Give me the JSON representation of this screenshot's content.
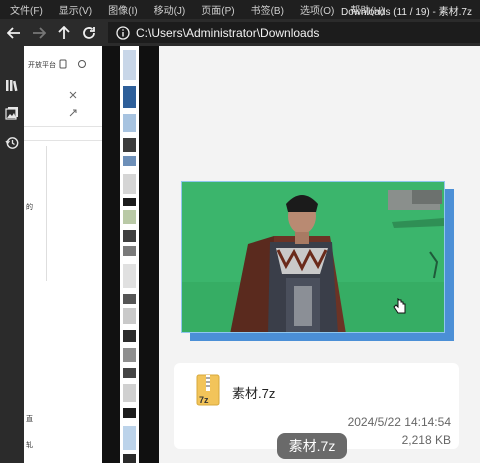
{
  "menubar": {
    "items": [
      "文件(F)",
      "显示(V)",
      "图像(I)",
      "移动(J)",
      "页面(P)",
      "书签(B)",
      "选项(O)",
      "帮助(H)"
    ],
    "window_title": "Downloads (11 / 19) - 素材.7z"
  },
  "toolbar": {
    "icons": [
      "back-arrow-icon",
      "forward-arrow-icon",
      "up-arrow-icon",
      "refresh-icon"
    ],
    "address": "C:\\Users\\Administrator\\Downloads"
  },
  "sidebar": {
    "icons": [
      "library-icon",
      "gallery-icon",
      "history-icon"
    ]
  },
  "background_window": {
    "fragment_top": "开放平台",
    "fragment_mid": "的",
    "fragment_low1": "直",
    "fragment_low2": "轧"
  },
  "file_card": {
    "icon_label": "7z",
    "name": "素材.7z",
    "date": "2024/5/22 14:14:54",
    "size": "2,218 KB"
  },
  "tooltip": {
    "text": "素材.7z"
  },
  "colors": {
    "accent_blue": "#4b8fd6",
    "green_screen": "#3bb56c"
  }
}
